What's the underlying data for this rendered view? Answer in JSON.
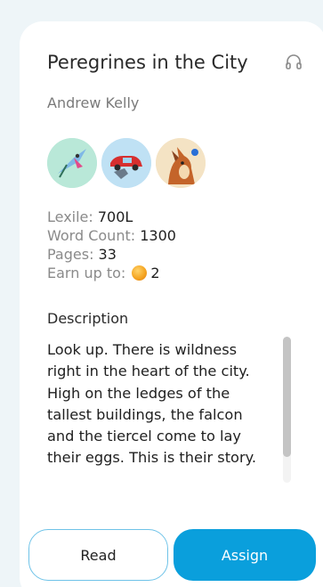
{
  "book": {
    "title": "Peregrines in the City",
    "author": "Andrew Kelly",
    "audio_icon": "headphones-icon",
    "avatars": [
      "falcon-avatar",
      "red-car-avatar",
      "dog-avatar"
    ]
  },
  "stats": {
    "lexile_label": "Lexile: ",
    "lexile_value": "700L",
    "word_count_label": "Word Count: ",
    "word_count_value": "1300",
    "pages_label": "Pages: ",
    "pages_value": "33",
    "earn_label": "Earn up to: ",
    "earn_value": "2",
    "earn_icon": "coin-icon"
  },
  "description": {
    "heading": "Description",
    "text": "Look up. There is wildness right in the heart of the city. High on the ledges of the tallest buildings, the falcon and the tiercel come to lay their eggs. This is their story."
  },
  "actions": {
    "read_label": "Read",
    "assign_label": "Assign"
  },
  "colors": {
    "accent": "#0a9fdc",
    "read_border": "#6fc3e8",
    "background": "#eef5f8"
  }
}
